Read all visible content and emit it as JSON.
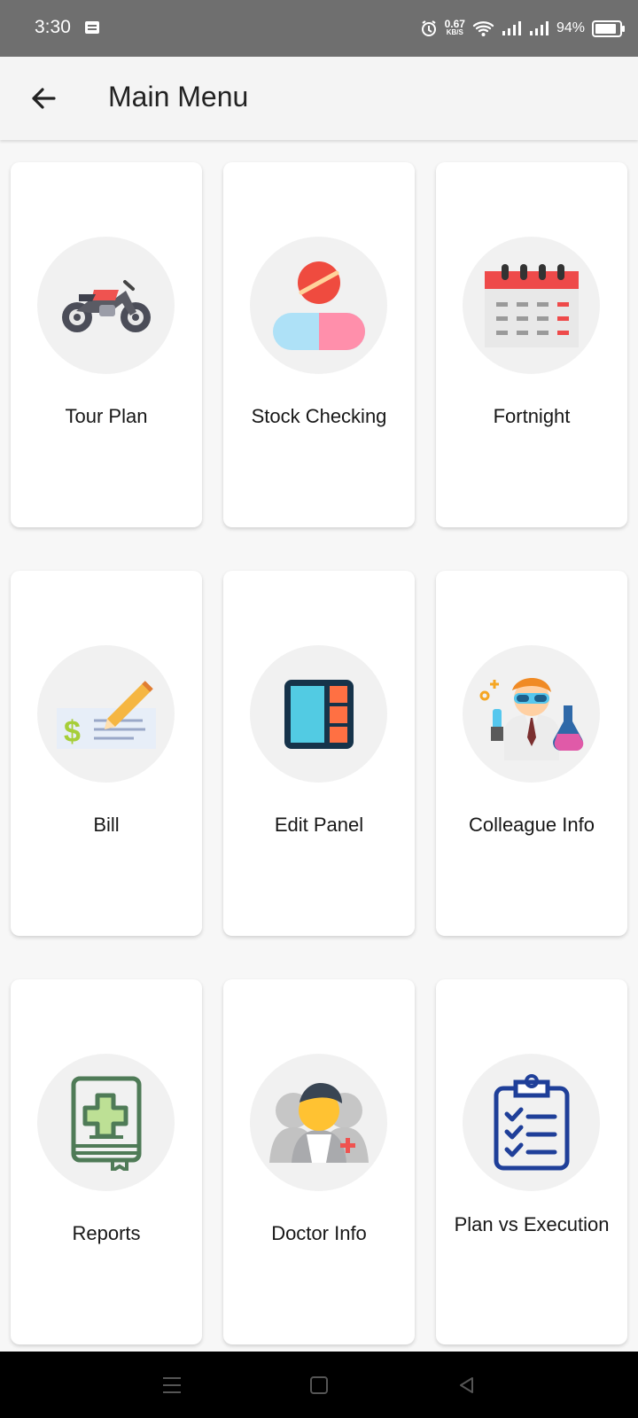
{
  "status_bar": {
    "time": "3:30",
    "speed_value": "0.67",
    "speed_unit": "KB/S",
    "battery": "94%",
    "battery_level": 0.94,
    "icons": [
      "message-icon",
      "alarm-icon",
      "wifi-icon",
      "signal-icon",
      "signal-icon",
      "battery-icon"
    ]
  },
  "app_bar": {
    "title": "Main Menu",
    "back_icon": "arrow-left-icon"
  },
  "menu": {
    "items": [
      {
        "label": "Tour Plan",
        "icon": "motorcycle-icon"
      },
      {
        "label": "Stock Checking",
        "icon": "pills-icon"
      },
      {
        "label": "Fortnight",
        "icon": "calendar-icon"
      },
      {
        "label": "Bill",
        "icon": "cheque-icon"
      },
      {
        "label": "Edit Panel",
        "icon": "panel-icon"
      },
      {
        "label": "Colleague Info",
        "icon": "scientist-icon"
      },
      {
        "label": "Reports",
        "icon": "medical-book-icon"
      },
      {
        "label": "Doctor Info",
        "icon": "doctor-icon"
      },
      {
        "label": "Plan vs Execution",
        "icon": "checklist-icon"
      }
    ]
  },
  "navigation": {
    "icons": [
      "menu-icon",
      "home-icon",
      "back-icon"
    ]
  },
  "colors": {
    "status_bar": "#6f6f6f",
    "app_bar": "#f4f4f4",
    "background": "#f7f7f7",
    "accent_red": "#ee4a4a"
  }
}
